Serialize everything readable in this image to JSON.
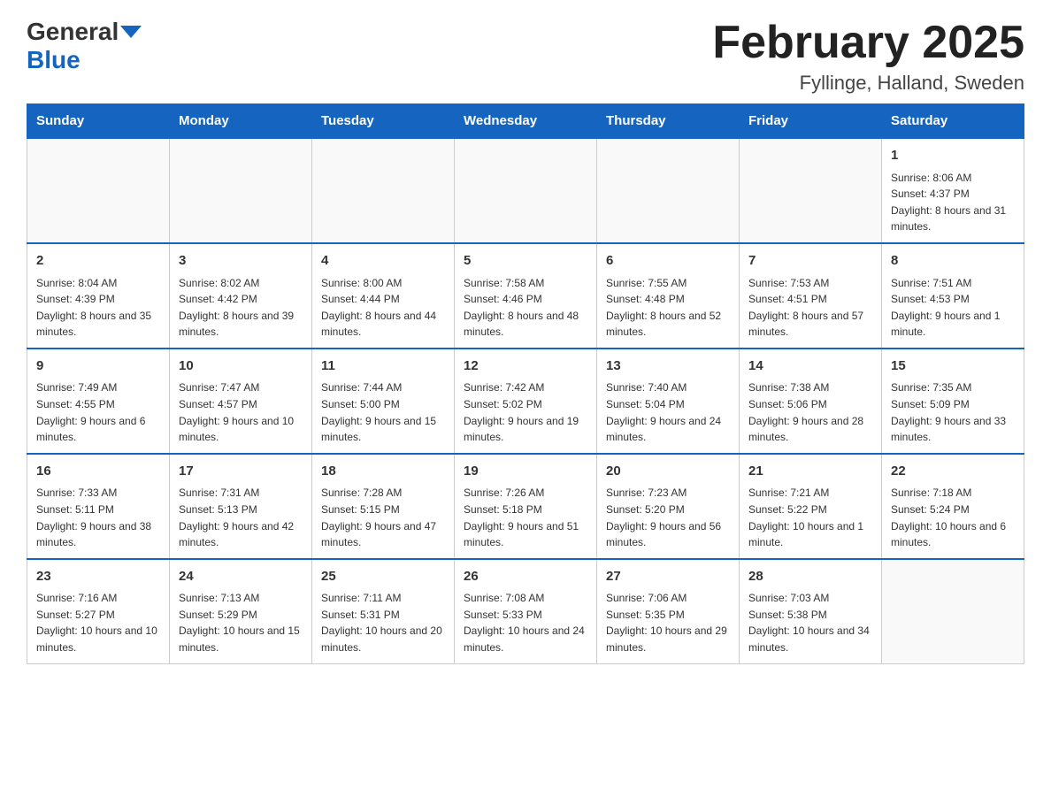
{
  "header": {
    "logo_general": "General",
    "logo_blue": "Blue",
    "month_title": "February 2025",
    "location": "Fyllinge, Halland, Sweden"
  },
  "weekdays": [
    "Sunday",
    "Monday",
    "Tuesday",
    "Wednesday",
    "Thursday",
    "Friday",
    "Saturday"
  ],
  "weeks": [
    [
      {
        "day": "",
        "info": ""
      },
      {
        "day": "",
        "info": ""
      },
      {
        "day": "",
        "info": ""
      },
      {
        "day": "",
        "info": ""
      },
      {
        "day": "",
        "info": ""
      },
      {
        "day": "",
        "info": ""
      },
      {
        "day": "1",
        "info": "Sunrise: 8:06 AM\nSunset: 4:37 PM\nDaylight: 8 hours and 31 minutes."
      }
    ],
    [
      {
        "day": "2",
        "info": "Sunrise: 8:04 AM\nSunset: 4:39 PM\nDaylight: 8 hours and 35 minutes."
      },
      {
        "day": "3",
        "info": "Sunrise: 8:02 AM\nSunset: 4:42 PM\nDaylight: 8 hours and 39 minutes."
      },
      {
        "day": "4",
        "info": "Sunrise: 8:00 AM\nSunset: 4:44 PM\nDaylight: 8 hours and 44 minutes."
      },
      {
        "day": "5",
        "info": "Sunrise: 7:58 AM\nSunset: 4:46 PM\nDaylight: 8 hours and 48 minutes."
      },
      {
        "day": "6",
        "info": "Sunrise: 7:55 AM\nSunset: 4:48 PM\nDaylight: 8 hours and 52 minutes."
      },
      {
        "day": "7",
        "info": "Sunrise: 7:53 AM\nSunset: 4:51 PM\nDaylight: 8 hours and 57 minutes."
      },
      {
        "day": "8",
        "info": "Sunrise: 7:51 AM\nSunset: 4:53 PM\nDaylight: 9 hours and 1 minute."
      }
    ],
    [
      {
        "day": "9",
        "info": "Sunrise: 7:49 AM\nSunset: 4:55 PM\nDaylight: 9 hours and 6 minutes."
      },
      {
        "day": "10",
        "info": "Sunrise: 7:47 AM\nSunset: 4:57 PM\nDaylight: 9 hours and 10 minutes."
      },
      {
        "day": "11",
        "info": "Sunrise: 7:44 AM\nSunset: 5:00 PM\nDaylight: 9 hours and 15 minutes."
      },
      {
        "day": "12",
        "info": "Sunrise: 7:42 AM\nSunset: 5:02 PM\nDaylight: 9 hours and 19 minutes."
      },
      {
        "day": "13",
        "info": "Sunrise: 7:40 AM\nSunset: 5:04 PM\nDaylight: 9 hours and 24 minutes."
      },
      {
        "day": "14",
        "info": "Sunrise: 7:38 AM\nSunset: 5:06 PM\nDaylight: 9 hours and 28 minutes."
      },
      {
        "day": "15",
        "info": "Sunrise: 7:35 AM\nSunset: 5:09 PM\nDaylight: 9 hours and 33 minutes."
      }
    ],
    [
      {
        "day": "16",
        "info": "Sunrise: 7:33 AM\nSunset: 5:11 PM\nDaylight: 9 hours and 38 minutes."
      },
      {
        "day": "17",
        "info": "Sunrise: 7:31 AM\nSunset: 5:13 PM\nDaylight: 9 hours and 42 minutes."
      },
      {
        "day": "18",
        "info": "Sunrise: 7:28 AM\nSunset: 5:15 PM\nDaylight: 9 hours and 47 minutes."
      },
      {
        "day": "19",
        "info": "Sunrise: 7:26 AM\nSunset: 5:18 PM\nDaylight: 9 hours and 51 minutes."
      },
      {
        "day": "20",
        "info": "Sunrise: 7:23 AM\nSunset: 5:20 PM\nDaylight: 9 hours and 56 minutes."
      },
      {
        "day": "21",
        "info": "Sunrise: 7:21 AM\nSunset: 5:22 PM\nDaylight: 10 hours and 1 minute."
      },
      {
        "day": "22",
        "info": "Sunrise: 7:18 AM\nSunset: 5:24 PM\nDaylight: 10 hours and 6 minutes."
      }
    ],
    [
      {
        "day": "23",
        "info": "Sunrise: 7:16 AM\nSunset: 5:27 PM\nDaylight: 10 hours and 10 minutes."
      },
      {
        "day": "24",
        "info": "Sunrise: 7:13 AM\nSunset: 5:29 PM\nDaylight: 10 hours and 15 minutes."
      },
      {
        "day": "25",
        "info": "Sunrise: 7:11 AM\nSunset: 5:31 PM\nDaylight: 10 hours and 20 minutes."
      },
      {
        "day": "26",
        "info": "Sunrise: 7:08 AM\nSunset: 5:33 PM\nDaylight: 10 hours and 24 minutes."
      },
      {
        "day": "27",
        "info": "Sunrise: 7:06 AM\nSunset: 5:35 PM\nDaylight: 10 hours and 29 minutes."
      },
      {
        "day": "28",
        "info": "Sunrise: 7:03 AM\nSunset: 5:38 PM\nDaylight: 10 hours and 34 minutes."
      },
      {
        "day": "",
        "info": ""
      }
    ]
  ]
}
